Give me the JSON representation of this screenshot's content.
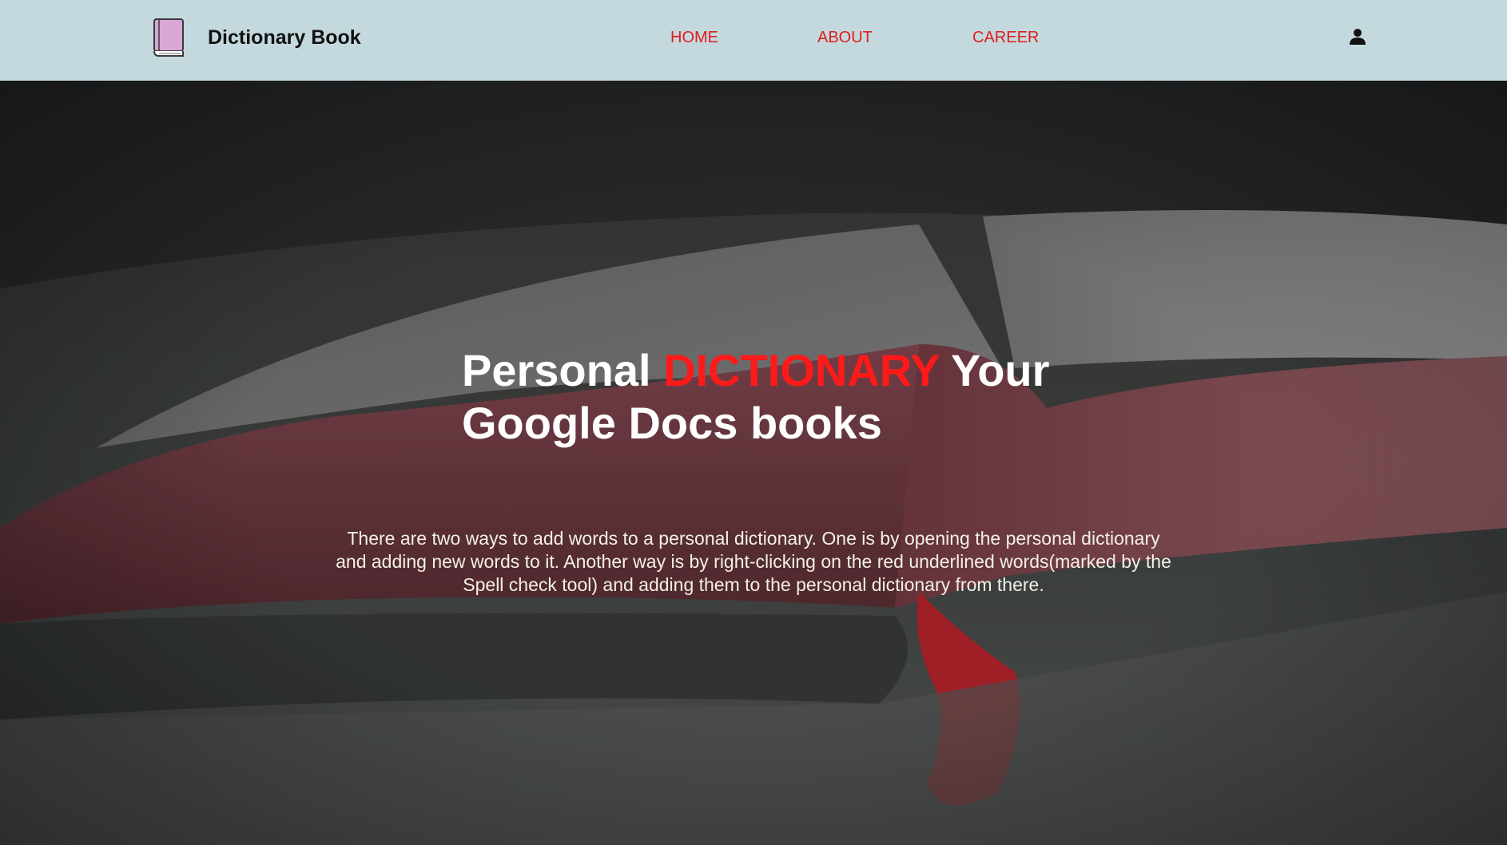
{
  "header": {
    "brand_name": "Dictionary Book",
    "logo_icon": "book-icon",
    "user_icon": "user-icon",
    "nav": [
      {
        "label": "HOME"
      },
      {
        "label": "ABOUT"
      },
      {
        "label": "CAREER"
      }
    ]
  },
  "hero": {
    "title_part1": "Personal ",
    "title_accent": "DICTIONARY",
    "title_part2": " Your Google Docs books",
    "description": "There are two ways to add words to a personal dictionary. One is by opening the personal dictionary and adding new words to it. Another way is by right-clicking on the red underlined words(marked by the Spell check tool) and adding them to the personal dictionary from there.",
    "background_image": "open-book-photo"
  },
  "colors": {
    "nav_background": "#c4d9de",
    "nav_link": "#e01d1d",
    "title_accent": "#ff1a1a",
    "title_text": "#ffffff",
    "description_text": "#f3f0e6"
  }
}
